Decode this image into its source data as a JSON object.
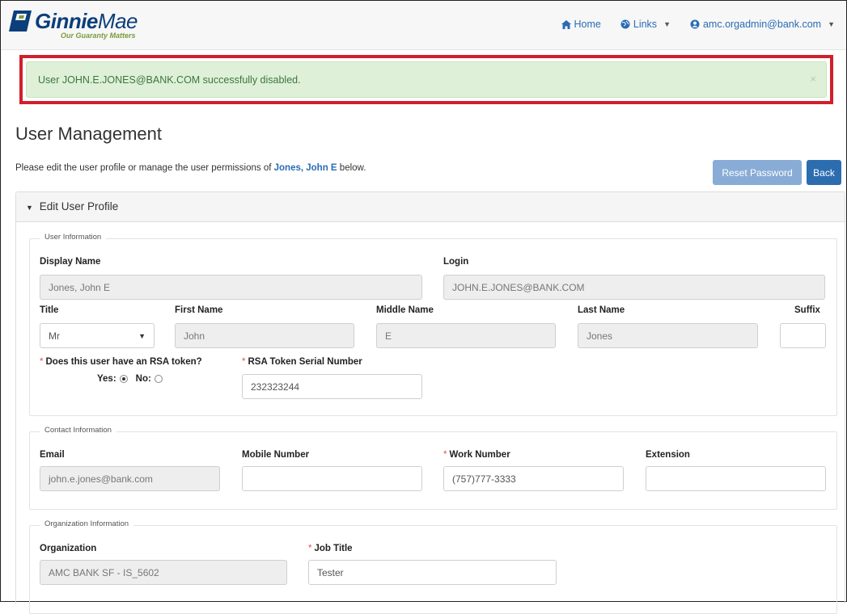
{
  "header": {
    "brand_bold": "Ginnie",
    "brand_light": "Mae",
    "tagline": "Our Guaranty Matters",
    "nav": {
      "home_label": "Home",
      "links_label": "Links",
      "user_label": "amc.orgadmin@bank.com"
    }
  },
  "alert": {
    "message": "User JOHN.E.JONES@BANK.COM successfully disabled.",
    "close": "×"
  },
  "page": {
    "title": "User Management",
    "intro_prefix": "Please edit the user profile or manage the user permissions of",
    "intro_name": "Jones, John E",
    "intro_suffix": "below.",
    "reset_password_label": "Reset Password",
    "back_label": "Back"
  },
  "panel": {
    "title": "Edit User Profile",
    "user_info": {
      "legend": "User Information",
      "display_name_label": "Display Name",
      "display_name_value": "Jones, John E",
      "login_label": "Login",
      "login_value": "JOHN.E.JONES@BANK.COM",
      "title_label": "Title",
      "title_value": "Mr",
      "first_name_label": "First Name",
      "first_name_value": "John",
      "middle_name_label": "Middle Name",
      "middle_name_value": "E",
      "last_name_label": "Last Name",
      "last_name_value": "Jones",
      "suffix_label": "Suffix",
      "suffix_value": "",
      "rsa_question": "Does this user have an RSA token?",
      "rsa_yes_label": "Yes:",
      "rsa_no_label": "No:",
      "rsa_selected": "yes",
      "rsa_serial_label": "RSA Token Serial Number",
      "rsa_serial_value": "232323244"
    },
    "contact_info": {
      "legend": "Contact Information",
      "email_label": "Email",
      "email_value": "john.e.jones@bank.com",
      "mobile_label": "Mobile Number",
      "mobile_value": "",
      "work_label": "Work Number",
      "work_value": "(757)777-3333",
      "extension_label": "Extension",
      "extension_value": ""
    },
    "org_info": {
      "legend": "Organization Information",
      "organization_label": "Organization",
      "organization_value": "AMC BANK SF - IS_5602",
      "job_title_label": "Job Title",
      "job_title_value": "Tester"
    }
  },
  "colors": {
    "brand_blue": "#0b3e7a",
    "link_blue": "#2a6bb5",
    "alert_bg": "#dff0d8",
    "alert_text": "#3c763d",
    "highlight_red": "#d0202a",
    "required": "#d9534f"
  }
}
